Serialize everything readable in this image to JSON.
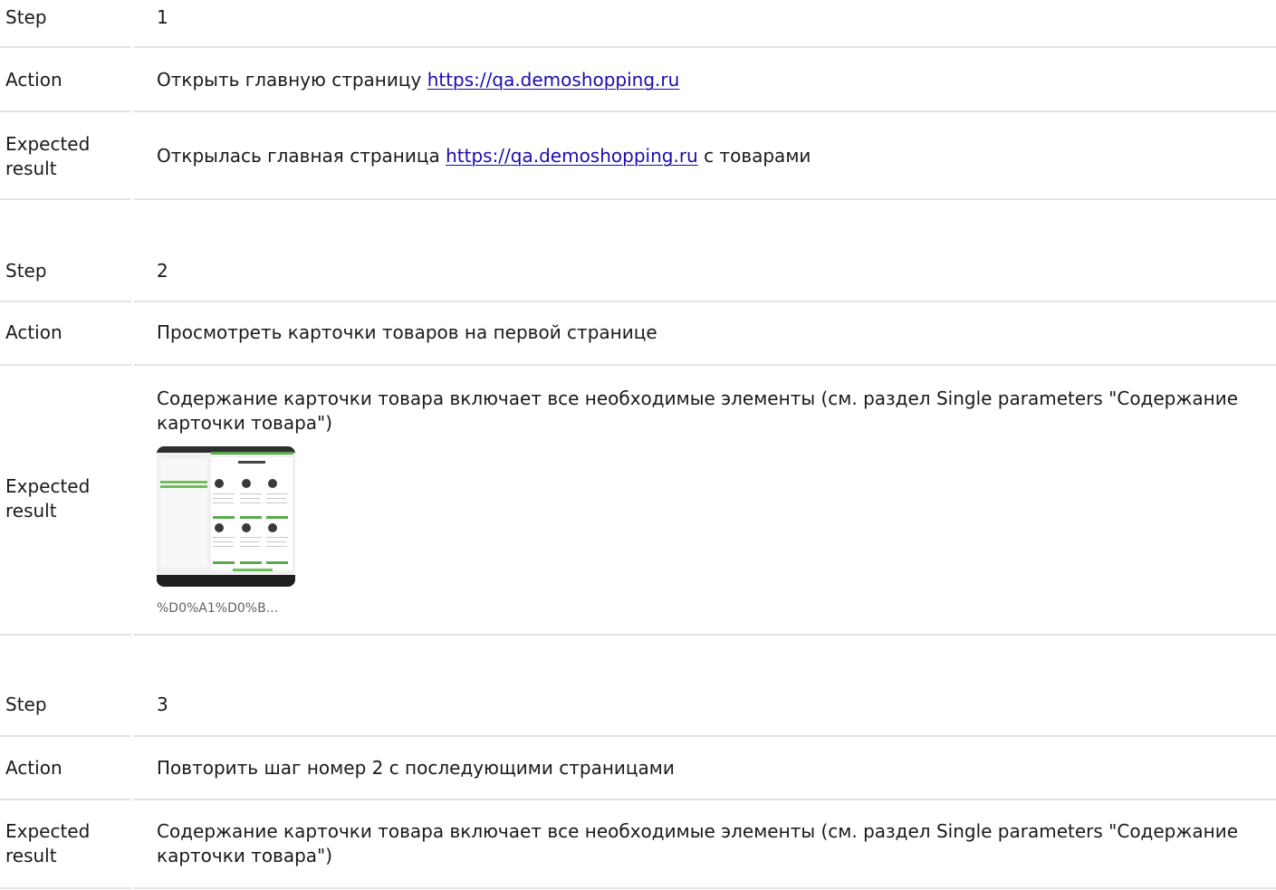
{
  "labels": {
    "step": "Step",
    "action": "Action",
    "expected_line1": "Expected",
    "expected_line2": "result"
  },
  "steps": [
    {
      "number": "1",
      "action": "Открыть главную страницу",
      "action_link": "https://qa.demoshopping.ru",
      "expected_prefix": "Открылась главная страница",
      "expected_link": "https://qa.demoshopping.ru",
      "expected_suffix": "с товарами"
    },
    {
      "number": "2",
      "action": "Просмотреть карточки товаров на первой странице",
      "expected": "Содержание карточки товара включает все необходимые элементы (см. раздел Single parameters \"Содержание карточки товара\")",
      "attachment_caption": "%D0%A1%D0%B..."
    },
    {
      "number": "3",
      "action": "Повторить шаг номер 2 с последующими страницами",
      "expected": "Содержание карточки товара включает все необходимые элементы (см. раздел Single parameters \"Содержание карточки товара\")"
    }
  ]
}
